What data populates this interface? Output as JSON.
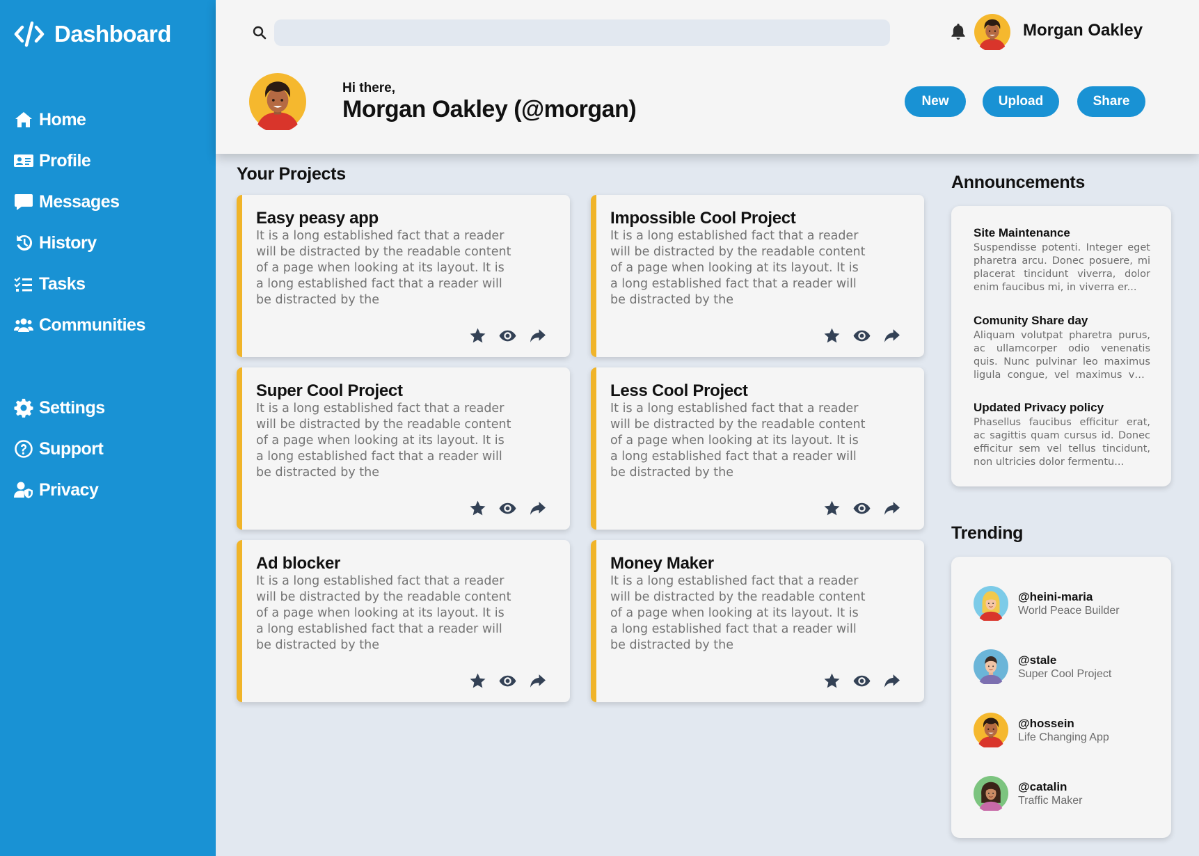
{
  "sidebar": {
    "brand": "Dashboard",
    "nav": [
      {
        "label": "Home",
        "icon": "home-icon"
      },
      {
        "label": "Profile",
        "icon": "id-card-icon"
      },
      {
        "label": "Messages",
        "icon": "message-icon"
      },
      {
        "label": "History",
        "icon": "history-icon"
      },
      {
        "label": "Tasks",
        "icon": "tasks-icon"
      },
      {
        "label": "Communities",
        "icon": "users-icon"
      }
    ],
    "secondary": [
      {
        "label": "Settings",
        "icon": "gear-icon"
      },
      {
        "label": "Support",
        "icon": "help-circle-icon"
      },
      {
        "label": "Privacy",
        "icon": "user-shield-icon"
      }
    ],
    "color": "#1992d4"
  },
  "header": {
    "search_placeholder": "",
    "username": "Morgan Oakley",
    "greeting": "Hi there,",
    "fullname": "Morgan Oakley (@morgan)",
    "buttons": [
      "New",
      "Upload",
      "Share"
    ]
  },
  "projects": {
    "title": "Your Projects",
    "accent": "#f0b429",
    "items": [
      {
        "title": "Easy peasy app",
        "desc": "It is a long established fact that a reader will be distracted by the readable content of a page when looking at its layout. It is a long established fact that a reader will be distracted by the"
      },
      {
        "title": "Impossible Cool Project",
        "desc": "It is a long established fact that a reader will be distracted by the readable content of a page when looking at its layout. It is a long established fact that a reader will be distracted by the"
      },
      {
        "title": "Super Cool Project",
        "desc": "It is a long established fact that a reader will be distracted by the readable content of a page when looking at its layout. It is a long established fact that a reader will be distracted by the"
      },
      {
        "title": "Less Cool Project",
        "desc": "It is a long established fact that a reader will be distracted by the readable content of a page when looking at its layout. It is a long established fact that a reader will be distracted by the"
      },
      {
        "title": "Ad blocker",
        "desc": "It is a long established fact that a reader will be distracted by the readable content of a page when looking at its layout. It is a long established fact that a reader will be distracted by the"
      },
      {
        "title": "Money Maker",
        "desc": "It is a long established fact that a reader will be distracted by the readable content of a page when looking at its layout. It is a long established fact that a reader will be distracted by the"
      }
    ]
  },
  "announcements": {
    "title": "Announcements",
    "items": [
      {
        "title": "Site Maintenance",
        "text": "Suspendisse potenti. Integer eget pharetra arcu. Donec posuere, mi placerat tincidunt viverra, dolor enim faucibus mi, in viverra er..."
      },
      {
        "title": "Comunity Share day",
        "text": "Aliquam volutpat pharetra purus, ac ullamcorper odio venenatis quis. Nunc pulvinar leo maximus ligula congue, vel maximus velit volutp..."
      },
      {
        "title": "Updated Privacy policy",
        "text": "Phasellus faucibus efficitur erat, ac sagittis quam cursus id. Donec efficitur sem vel tellus tincidunt, non ultricies dolor fermentu..."
      }
    ]
  },
  "trending": {
    "title": "Trending",
    "items": [
      {
        "handle": "@heini-maria",
        "project": "World Peace Builder"
      },
      {
        "handle": "@stale",
        "project": "Super Cool Project"
      },
      {
        "handle": "@hossein",
        "project": "Life Changing App"
      },
      {
        "handle": "@catalin",
        "project": "Traffic Maker"
      }
    ]
  }
}
